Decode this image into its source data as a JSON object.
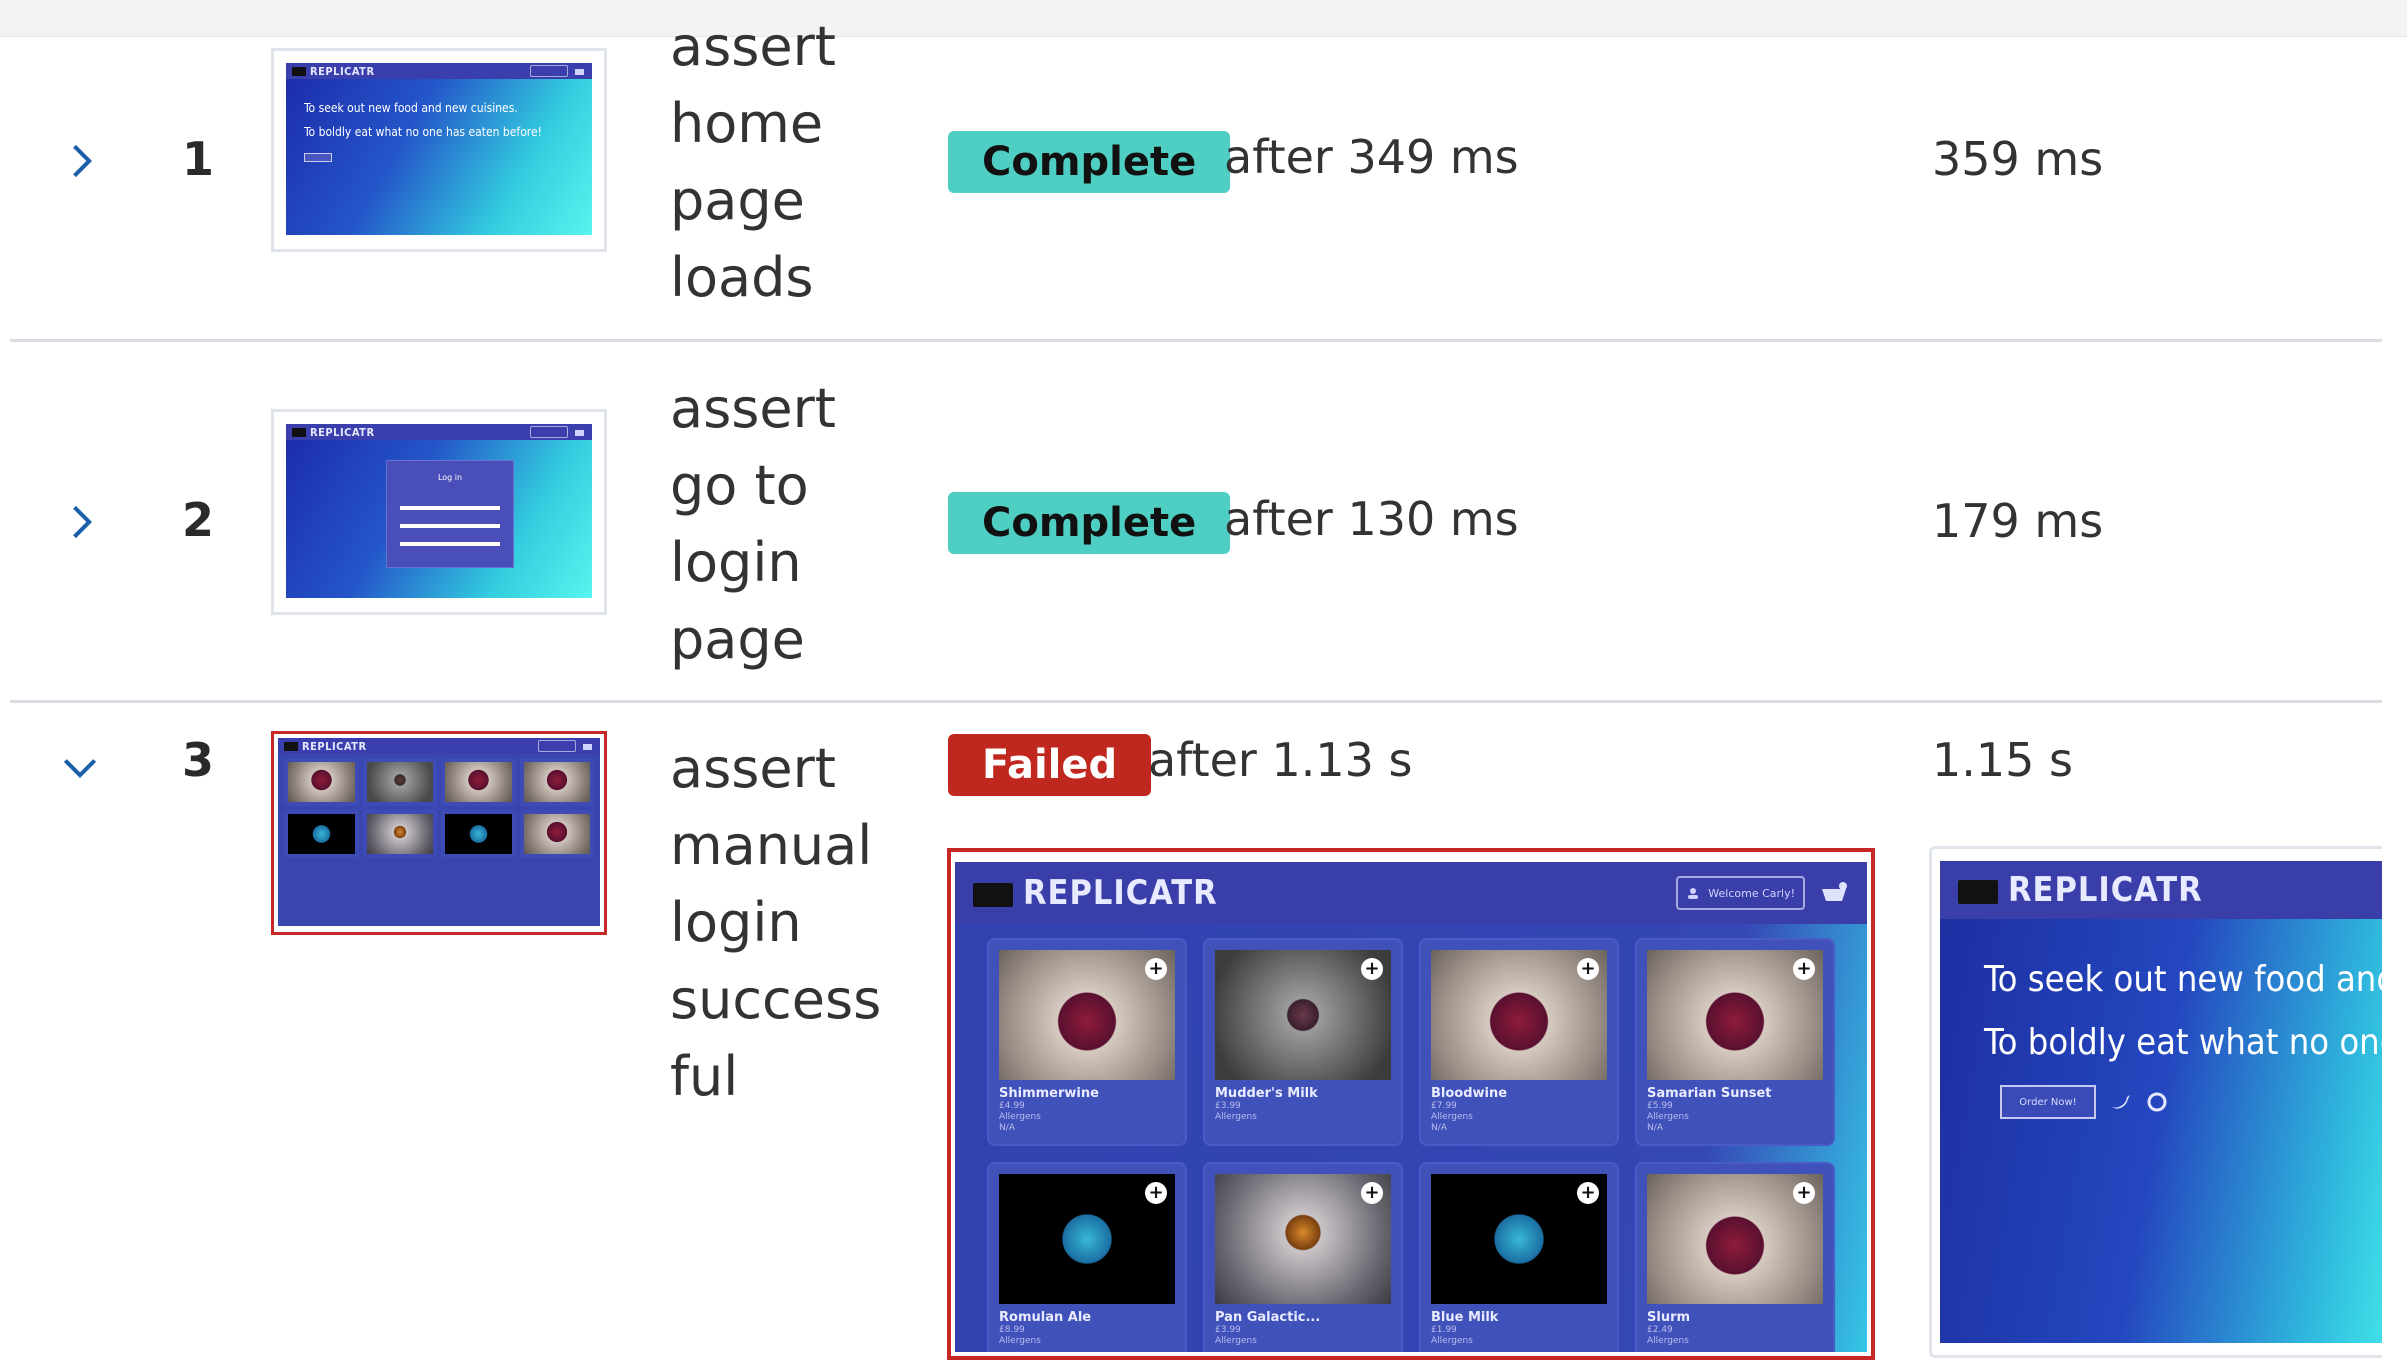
{
  "tests": [
    {
      "index": "1",
      "title": "assert home page loads",
      "status": "Complete",
      "after": "after 349 ms",
      "duration": "359 ms",
      "expanded": false
    },
    {
      "index": "2",
      "title": "assert go to login page",
      "status": "Complete",
      "after": "after 130 ms",
      "duration": "179 ms",
      "expanded": false
    },
    {
      "index": "3",
      "title": "assert manual login success ful",
      "status": "Failed",
      "after": "after 1.13 s",
      "duration": "1.15 s",
      "expanded": true
    }
  ],
  "app": {
    "logo": "REPLICATR",
    "hero_line1": "To seek out new food and new cuisines.",
    "hero_line2": "To boldly eat what no one has eaten before!",
    "big_hero_line1": "To seek out new food and n",
    "big_hero_line2": "To boldly eat what no one h",
    "order_button": "Order Now!",
    "login_title": "Log in",
    "welcome": "Welcome Carly!",
    "products": [
      {
        "name": "Shimmerwine",
        "price": "£4.99"
      },
      {
        "name": "Mudder's Milk",
        "price": "£3.99"
      },
      {
        "name": "Bloodwine",
        "price": "£7.99"
      },
      {
        "name": "Samarian Sunset",
        "price": "£5.99"
      },
      {
        "name": "Romulan Ale",
        "price": "£8.99"
      },
      {
        "name": "Pan Galactic...",
        "price": "£3.99"
      },
      {
        "name": "Blue Milk",
        "price": "£1.99"
      },
      {
        "name": "Slurm",
        "price": "£2.49"
      }
    ],
    "allergens_label": "Allergens",
    "allergens_value": "N/A"
  },
  "colors": {
    "complete": "#4fcfc3",
    "failed": "#c0271f",
    "chevron": "#1b5fa8",
    "selected_border": "#c62828"
  }
}
